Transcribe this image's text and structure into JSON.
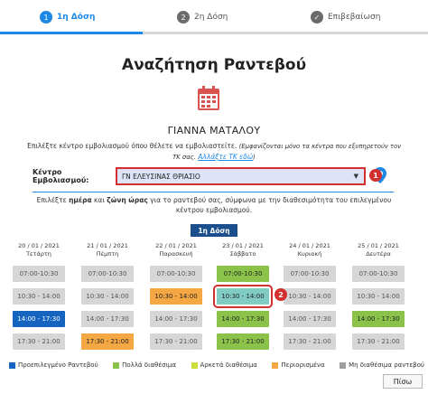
{
  "stepper": {
    "steps": [
      {
        "number": "1",
        "label": "1η Δόση",
        "state": "active"
      },
      {
        "number": "2",
        "label": "2η Δόση",
        "state": "inactive"
      },
      {
        "number": "✓",
        "label": "Επιβεβαίωση",
        "state": "inactive"
      }
    ]
  },
  "page_title": "Αναζήτηση Ραντεβού",
  "patient_name": "ΓΙΑΝΝΑ ΜΑΤΑΛΟΥ",
  "intro": {
    "text": "Επιλέξτε κέντρο εμβολιασμού όπου θέλετε να εμβολιαστείτε.",
    "note": "(Εμφανίζονται μόνο τα κέντρα που εξυπηρετούν τον ΤΚ σας.",
    "link": "Αλλάξτε ΤΚ εδώ",
    "note_end": ")"
  },
  "center": {
    "label": "Κέντρο Εμβολιασμού:",
    "selected": "ΓΝ ΕΛΕΥΣΙΝΑΣ ΘΡΙΑΣΙΟ",
    "badge": "1"
  },
  "instructions": {
    "pre": "Επιλέξτε ",
    "day": "ημέρα",
    "mid": " και ",
    "slot": "ζώνη ώρας",
    "post": " για το ραντεβού σας, σύμφωνα με την διαθεσιμότητα του επιλεγμένου κέντρου εμβολιασμού."
  },
  "dose_badge": "1η Δόση",
  "selection_badge": "2",
  "days": [
    {
      "date": "20 / 01 / 2021",
      "weekday": "Τετάρτη",
      "slots": [
        {
          "time": "07:00-10:30",
          "status": "gray"
        },
        {
          "time": "10:30 - 14:00",
          "status": "gray"
        },
        {
          "time": "14:00 - 17:30",
          "status": "blue"
        },
        {
          "time": "17:30 - 21:00",
          "status": "gray"
        }
      ]
    },
    {
      "date": "21 / 01 / 2021",
      "weekday": "Πέμπτη",
      "slots": [
        {
          "time": "07:00-10:30",
          "status": "gray"
        },
        {
          "time": "10:30 - 14:00",
          "status": "gray"
        },
        {
          "time": "14:00 - 17:30",
          "status": "gray"
        },
        {
          "time": "17:30 - 21:00",
          "status": "orange"
        }
      ]
    },
    {
      "date": "22 / 01 / 2021",
      "weekday": "Παρασκευή",
      "slots": [
        {
          "time": "07:00-10:30",
          "status": "gray"
        },
        {
          "time": "10:30 - 14:00",
          "status": "orange"
        },
        {
          "time": "14:00 - 17:30",
          "status": "gray"
        },
        {
          "time": "17:30 - 21:00",
          "status": "gray"
        }
      ]
    },
    {
      "date": "23 / 01 / 2021",
      "weekday": "Σάββατο",
      "slots": [
        {
          "time": "07:00-10:30",
          "status": "green"
        },
        {
          "time": "10:30 - 14:00",
          "status": "teal"
        },
        {
          "time": "14:00 - 17:30",
          "status": "green"
        },
        {
          "time": "17:30 - 21:00",
          "status": "green"
        }
      ]
    },
    {
      "date": "24 / 01 / 2021",
      "weekday": "Κυριακή",
      "slots": [
        {
          "time": "07:00-10:30",
          "status": "gray"
        },
        {
          "time": "10:30 - 14:00",
          "status": "gray"
        },
        {
          "time": "14:00 - 17:30",
          "status": "gray"
        },
        {
          "time": "17:30 - 21:00",
          "status": "gray"
        }
      ]
    },
    {
      "date": "25 / 01 / 2021",
      "weekday": "Δευτέρα",
      "slots": [
        {
          "time": "07:00-10:30",
          "status": "gray"
        },
        {
          "time": "10:30 - 14:00",
          "status": "gray"
        },
        {
          "time": "14:00 - 17:30",
          "status": "green"
        },
        {
          "time": "17:30 - 21:00",
          "status": "gray"
        }
      ]
    }
  ],
  "legend": [
    {
      "label": "Προεπιλεγμένο Ραντεβού",
      "color": "#1565c0"
    },
    {
      "label": "Πολλά διαθέσιμα",
      "color": "#8bc34a"
    },
    {
      "label": "Αρκετά διαθέσιμα",
      "color": "#cddc39"
    },
    {
      "label": "Περιορισμένα",
      "color": "#f4a742"
    },
    {
      "label": "Μη διαθέσιμα ραντεβού",
      "color": "#9e9e9e"
    }
  ],
  "back_button": "Πίσω",
  "colors": {
    "accent": "#1e88e5",
    "highlight": "#d32f2f",
    "calendar_icon": "#d9534f"
  }
}
